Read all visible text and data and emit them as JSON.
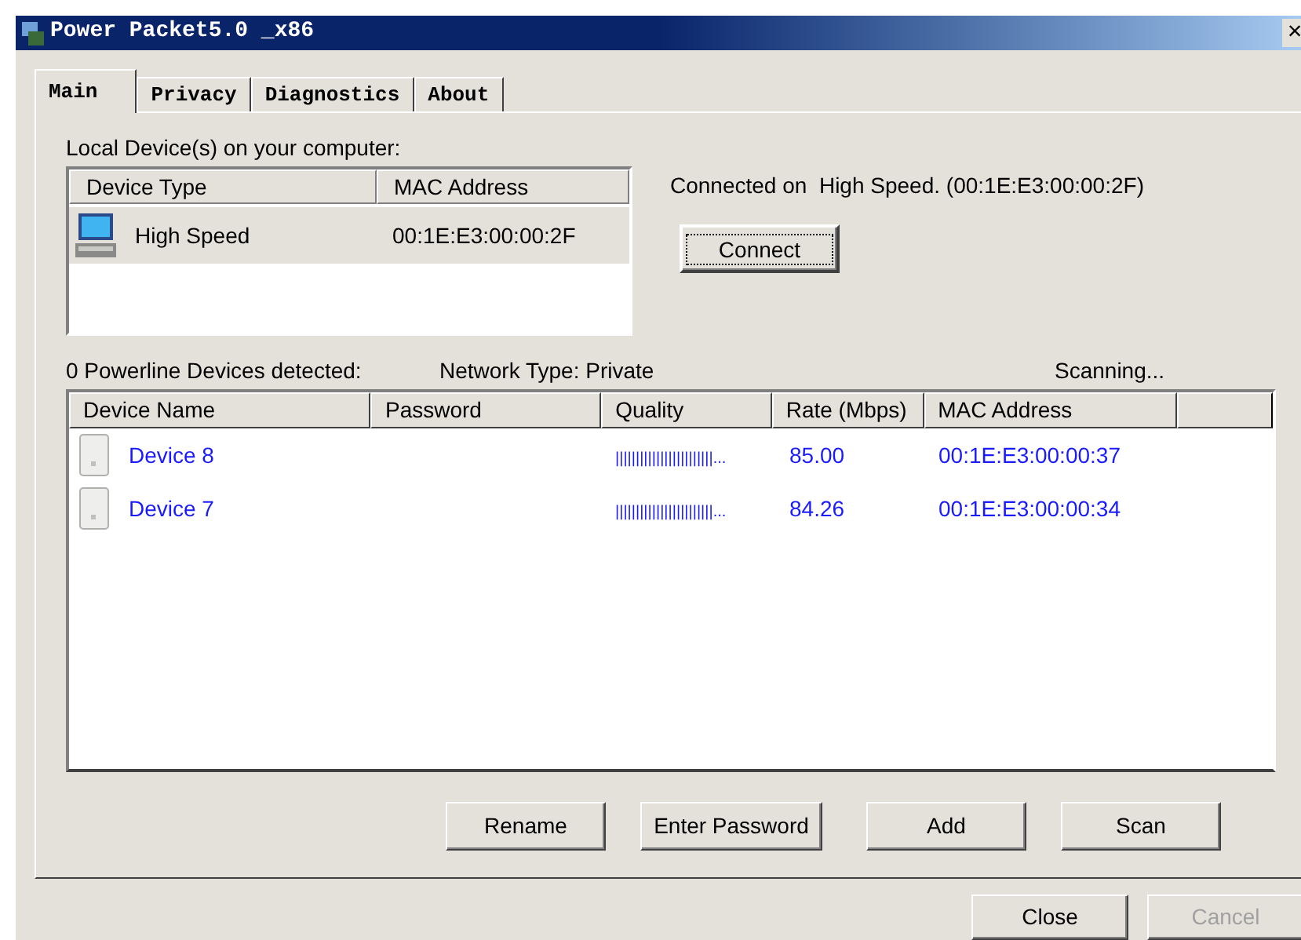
{
  "window": {
    "title": "Power Packet5.0 _x86",
    "close": "×"
  },
  "tabs": [
    {
      "label": "Main",
      "selected": true
    },
    {
      "label": "Privacy",
      "selected": false
    },
    {
      "label": "Diagnostics",
      "selected": false
    },
    {
      "label": "About",
      "selected": false
    }
  ],
  "local_devices": {
    "label": "Local Device(s) on your computer:",
    "columns": [
      "Device Type",
      "MAC Address"
    ],
    "rows": [
      {
        "device_type": "High Speed",
        "mac": "00:1E:E3:00:00:2F",
        "selected": true
      }
    ]
  },
  "connection_status": "Connected on  High Speed. (00:1E:E3:00:00:2F)",
  "connect_button": "Connect",
  "status_line": {
    "detected": "0 Powerline Devices detected:",
    "network_type": "Network Type: Private",
    "scanning": "Scanning..."
  },
  "powerline_devices": {
    "columns": [
      "Device Name",
      "Password",
      "Quality",
      "Rate (Mbps)",
      "MAC Address"
    ],
    "rows": [
      {
        "name": "Device 8",
        "password": "",
        "quality": "||||||||||||||||||||||||...",
        "rate": "85.00",
        "mac": "00:1E:E3:00:00:37"
      },
      {
        "name": "Device 7",
        "password": "",
        "quality": "||||||||||||||||||||||||...",
        "rate": "84.26",
        "mac": "00:1E:E3:00:00:34"
      }
    ]
  },
  "action_buttons": [
    {
      "label": "Rename"
    },
    {
      "label": "Enter Password"
    },
    {
      "label": "Add"
    },
    {
      "label": "Scan"
    }
  ],
  "footer_buttons": [
    {
      "label": "Close",
      "disabled": false
    },
    {
      "label": "Cancel",
      "disabled": true
    }
  ]
}
